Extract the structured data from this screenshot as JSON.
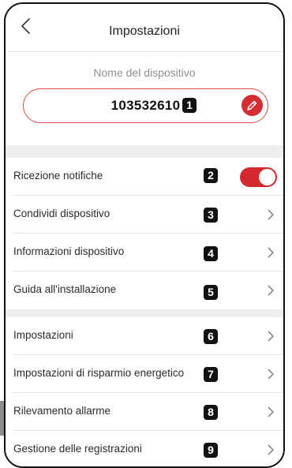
{
  "header": {
    "title": "Impostazioni",
    "back_icon": "chevron-left-icon"
  },
  "device_name": {
    "label": "Nome del dispositivo",
    "value": "103532610",
    "badge": "1",
    "edit_icon": "pencil-icon"
  },
  "colors": {
    "accent": "#d42d34",
    "separator": "#eeeeee"
  },
  "group1": [
    {
      "label": "Ricezione notifiche",
      "badge": "2",
      "control": "toggle",
      "toggle_on": true
    },
    {
      "label": "Condividi dispositivo",
      "badge": "3",
      "control": "chevron"
    },
    {
      "label": "Informazioni dispositivo",
      "badge": "4",
      "control": "chevron"
    },
    {
      "label": "Guida all'installazione",
      "badge": "5",
      "control": "chevron"
    }
  ],
  "group2": [
    {
      "label": "Impostazioni",
      "badge": "6",
      "control": "chevron"
    },
    {
      "label": "Impostazioni di risparmio energetico",
      "badge": "7",
      "control": "chevron"
    },
    {
      "label": "Rilevamento allarme",
      "badge": "8",
      "control": "chevron"
    },
    {
      "label": "Gestione delle registrazioni",
      "badge": "9",
      "control": "chevron"
    }
  ]
}
